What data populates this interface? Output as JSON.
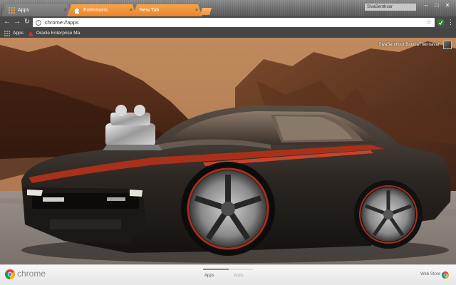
{
  "tabs": [
    {
      "label": "Apps",
      "close": "×"
    },
    {
      "label": "Extensions",
      "close": "×"
    },
    {
      "label": "New Tab",
      "close": "×"
    }
  ],
  "window": {
    "profile_name": "SivaSenthoor",
    "minimize": "–",
    "maximize": "□",
    "close": "✕"
  },
  "toolbar": {
    "back": "←",
    "forward": "→",
    "reload": "↻",
    "info": "i",
    "url": "chrome://apps",
    "star": "☆",
    "menu": "⋮"
  },
  "bookmarks": [
    {
      "label": "Apps",
      "icon": "apps-grid-icon"
    },
    {
      "label": "Oracle Enterprise Ma",
      "icon": "oracle-icon"
    }
  ],
  "content": {
    "user_name": "SivaSenthoor BandiaThennavan",
    "background": "muscle car in desert canyon"
  },
  "footer": {
    "brand": "chrome",
    "pages": [
      "Apps",
      "Apps"
    ],
    "active_page": 0,
    "webstore": "Web Store"
  },
  "colors": {
    "tab_orange": "#ee8d36",
    "toolbar": "#4a4a4a",
    "sky": "#b9825a",
    "car_body": "#2e2925",
    "stripe": "#b0301c"
  }
}
